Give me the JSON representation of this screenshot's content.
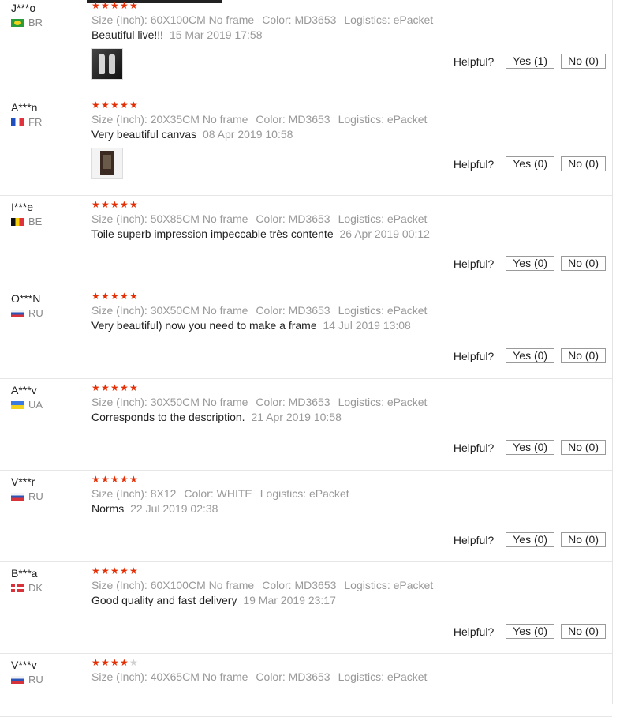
{
  "reviews": [
    {
      "user": "J***o",
      "country": "BR",
      "flag": "flag-br",
      "rating": 5,
      "attrs": [
        {
          "key": "Size (Inch):",
          "value": "60X100CM No frame"
        },
        {
          "key": "Color:",
          "value": "MD3653"
        },
        {
          "key": "Logistics:",
          "value": "ePacket"
        }
      ],
      "text": "Beautiful live!!!",
      "date": "15 Mar 2019 17:58",
      "has_image": true,
      "helpful_label": "Helpful?",
      "yes": "Yes (1)",
      "no": "No (0)"
    },
    {
      "user": "A***n",
      "country": "FR",
      "flag": "flag-fr",
      "rating": 5,
      "attrs": [
        {
          "key": "Size (Inch):",
          "value": "20X35CM No frame"
        },
        {
          "key": "Color:",
          "value": "MD3653"
        },
        {
          "key": "Logistics:",
          "value": "ePacket"
        }
      ],
      "text": "Very beautiful canvas",
      "date": "08 Apr 2019 10:58",
      "has_image": true,
      "helpful_label": "Helpful?",
      "yes": "Yes (0)",
      "no": "No (0)"
    },
    {
      "user": "I***e",
      "country": "BE",
      "flag": "flag-be",
      "rating": 5,
      "attrs": [
        {
          "key": "Size (Inch):",
          "value": "50X85CM No frame"
        },
        {
          "key": "Color:",
          "value": "MD3653"
        },
        {
          "key": "Logistics:",
          "value": "ePacket"
        }
      ],
      "text": "Toile superb impression impeccable très contente",
      "date": "26 Apr 2019 00:12",
      "has_image": false,
      "helpful_label": "Helpful?",
      "yes": "Yes (0)",
      "no": "No (0)"
    },
    {
      "user": "O***N",
      "country": "RU",
      "flag": "flag-ru",
      "rating": 5,
      "attrs": [
        {
          "key": "Size (Inch):",
          "value": "30X50CM No frame"
        },
        {
          "key": "Color:",
          "value": "MD3653"
        },
        {
          "key": "Logistics:",
          "value": "ePacket"
        }
      ],
      "text": "Very beautiful) now you need to make a frame",
      "date": "14 Jul 2019 13:08",
      "has_image": false,
      "helpful_label": "Helpful?",
      "yes": "Yes (0)",
      "no": "No (0)"
    },
    {
      "user": "A***v",
      "country": "UA",
      "flag": "flag-ua",
      "rating": 5,
      "attrs": [
        {
          "key": "Size (Inch):",
          "value": "30X50CM No frame"
        },
        {
          "key": "Color:",
          "value": "MD3653"
        },
        {
          "key": "Logistics:",
          "value": "ePacket"
        }
      ],
      "text": "Corresponds to the description.",
      "date": "21 Apr 2019 10:58",
      "has_image": false,
      "helpful_label": "Helpful?",
      "yes": "Yes (0)",
      "no": "No (0)"
    },
    {
      "user": "V***r",
      "country": "RU",
      "flag": "flag-ru",
      "rating": 5,
      "attrs": [
        {
          "key": "Size (Inch):",
          "value": "8X12"
        },
        {
          "key": "Color:",
          "value": "WHITE"
        },
        {
          "key": "Logistics:",
          "value": "ePacket"
        }
      ],
      "text": "Norms",
      "date": "22 Jul 2019 02:38",
      "has_image": false,
      "helpful_label": "Helpful?",
      "yes": "Yes (0)",
      "no": "No (0)"
    },
    {
      "user": "B***a",
      "country": "DK",
      "flag": "flag-dk",
      "rating": 5,
      "attrs": [
        {
          "key": "Size (Inch):",
          "value": "60X100CM No frame"
        },
        {
          "key": "Color:",
          "value": "MD3653"
        },
        {
          "key": "Logistics:",
          "value": "ePacket"
        }
      ],
      "text": "Good quality and fast delivery",
      "date": "19 Mar 2019 23:17",
      "has_image": false,
      "helpful_label": "Helpful?",
      "yes": "Yes (0)",
      "no": "No (0)"
    },
    {
      "user": "V***v",
      "country": "RU",
      "flag": "flag-ru",
      "rating": 4,
      "attrs": [
        {
          "key": "Size (Inch):",
          "value": "40X65CM No frame"
        },
        {
          "key": "Color:",
          "value": "MD3653"
        },
        {
          "key": "Logistics:",
          "value": "ePacket"
        }
      ],
      "text": "",
      "date": "",
      "has_image": false,
      "helpful_label": "",
      "yes": "",
      "no": ""
    }
  ],
  "colors": {
    "star": "#e62e04",
    "star_off": "#d0d0d0",
    "meta": "#999999",
    "border": "#e6e6e6"
  }
}
